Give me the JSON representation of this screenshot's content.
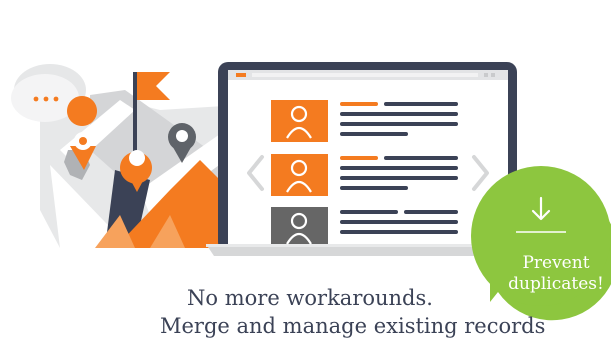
{
  "caption": {
    "line1": "No more workarounds.",
    "line2": "Merge and manage existing records"
  },
  "badge": {
    "line1": "Prevent",
    "line2": "duplicates!",
    "icon": "download-arrow-icon"
  },
  "chat_bubble": {
    "text": "..."
  },
  "records": [
    {
      "avatar_color": "#f47b20",
      "icon": "person-icon"
    },
    {
      "avatar_color": "#f47b20",
      "icon": "person-icon"
    },
    {
      "avatar_color": "#666666",
      "icon": "person-icon"
    }
  ],
  "colors": {
    "orange": "#f47b20",
    "navy": "#3b4256",
    "green": "#8dc63f",
    "gray": "#d6d7d8"
  }
}
